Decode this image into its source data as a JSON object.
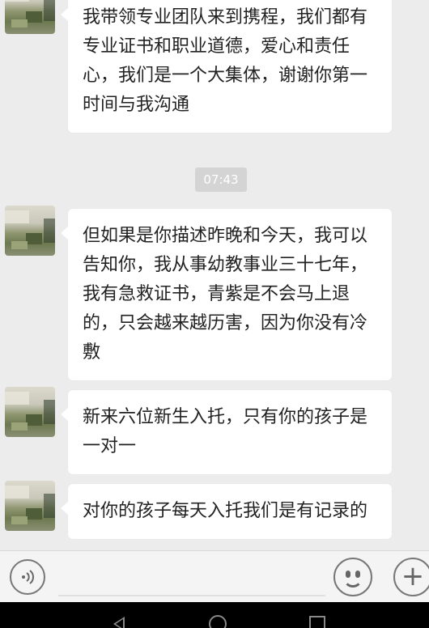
{
  "messages": [
    {
      "text": "我带领专业团队来到携程，我们都有专业证书和职业道德，爱心和责任心，我们是一个大集体，谢谢你第一时间与我沟通"
    },
    {
      "text": "但如果是你描述昨晚和今天，我可以告知你，我从事幼教事业三十七年，我有急救证书，青紫是不会马上退的，只会越来越历害，因为你没有冷敷"
    },
    {
      "text": "新来六位新生入托，只有你的孩子是一对一"
    },
    {
      "text": "对你的孩子每天入托我们是有记录的"
    }
  ],
  "timestamp": "07:43",
  "input_bar": {
    "voice_icon": "voice-icon",
    "emoji_icon": "emoji-icon",
    "plus_icon": "plus-icon"
  },
  "nav_bar": {
    "back_icon": "back-icon",
    "home_icon": "home-icon",
    "recent_icon": "recent-apps-icon"
  },
  "colors": {
    "chat_background": "#ececec",
    "bubble_background": "#ffffff",
    "timestamp_background": "#d4d4d4"
  }
}
